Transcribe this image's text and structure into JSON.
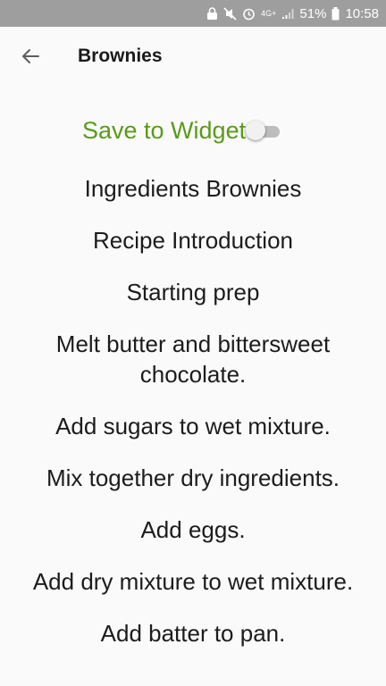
{
  "status_bar": {
    "network": "4G+",
    "battery": "51%",
    "time": "10:58"
  },
  "app_bar": {
    "title": "Brownies"
  },
  "widget": {
    "label": "Save to Widget",
    "enabled": false
  },
  "steps": [
    "Ingredients Brownies",
    "Recipe Introduction",
    "Starting prep",
    "Melt butter and bittersweet chocolate.",
    "Add sugars to wet mixture.",
    "Mix together dry ingredients.",
    "Add eggs.",
    "Add dry mixture to wet mixture.",
    "Add batter to pan."
  ],
  "colors": {
    "accent": "#5a9a1a",
    "statusbar": "#9e9e9e"
  }
}
